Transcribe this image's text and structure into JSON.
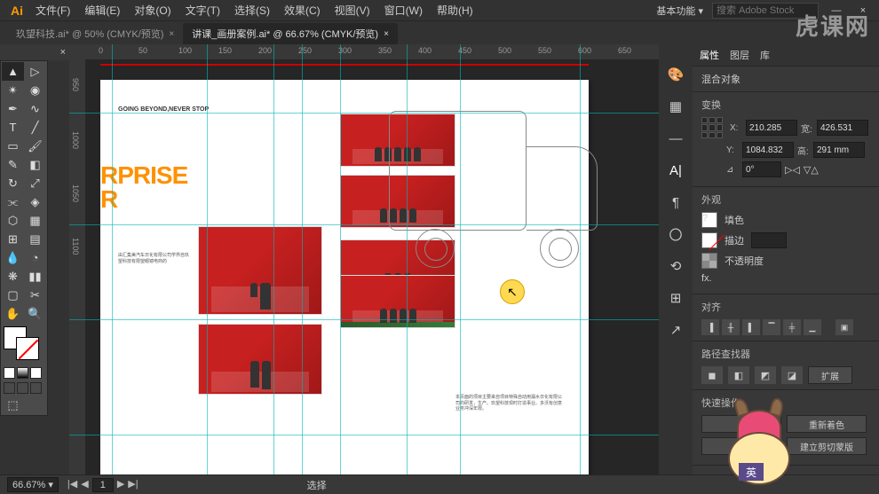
{
  "menubar": {
    "logo": "Ai",
    "items": [
      "文件(F)",
      "编辑(E)",
      "对象(O)",
      "文字(T)",
      "选择(S)",
      "效果(C)",
      "视图(V)",
      "窗口(W)",
      "帮助(H)"
    ],
    "workspace_label": "基本功能",
    "search_placeholder": "搜索 Adobe Stock"
  },
  "tabs": [
    {
      "label": "玖望科技.ai* @ 50% (CMYK/预览)",
      "active": false
    },
    {
      "label": "讲课_画册案例.ai* @ 66.67% (CMYK/预览)",
      "active": true
    }
  ],
  "ruler_h": [
    "0",
    "50",
    "100",
    "150",
    "200",
    "250",
    "300",
    "350",
    "400",
    "450",
    "500",
    "550",
    "600",
    "650"
  ],
  "ruler_v": [
    "950",
    "1000",
    "1050",
    "1100"
  ],
  "artboard": {
    "subtitle": "GOING BEYOND,NEVER STOP",
    "title_line1": "RPRISE",
    "title_line2": "R",
    "body1": "由汇集美汽车日化有限公司学界自玖望科技有限望眼镜电商的",
    "body2": "本页面的项目主要来自项目特殊自动用漏水日化有限公司的研发，生产。玖望科技现时打造事业。多沃有创意业务冲深年限。"
  },
  "panels": {
    "tabs": [
      "属性",
      "图层",
      "库"
    ],
    "group_label": "混合对象",
    "transform": {
      "title": "变换",
      "x": "210.285",
      "w": "426.531",
      "y": "1084.832",
      "h": "291 mm",
      "angle": "0°"
    },
    "appearance": {
      "title": "外观",
      "fill": "填色",
      "stroke": "描边",
      "opacity": "不透明度",
      "fx": "fx."
    },
    "align": {
      "title": "对齐"
    },
    "pathfinder": {
      "title": "路径查找器",
      "expand": "扩展"
    },
    "quick": {
      "title": "快速操作",
      "b1": "重新着色",
      "b2": "建立剪切蒙版"
    }
  },
  "statusbar": {
    "zoom": "66.67%",
    "page": "1",
    "mode": "选择"
  },
  "watermark": "虎课网",
  "ime": "英"
}
